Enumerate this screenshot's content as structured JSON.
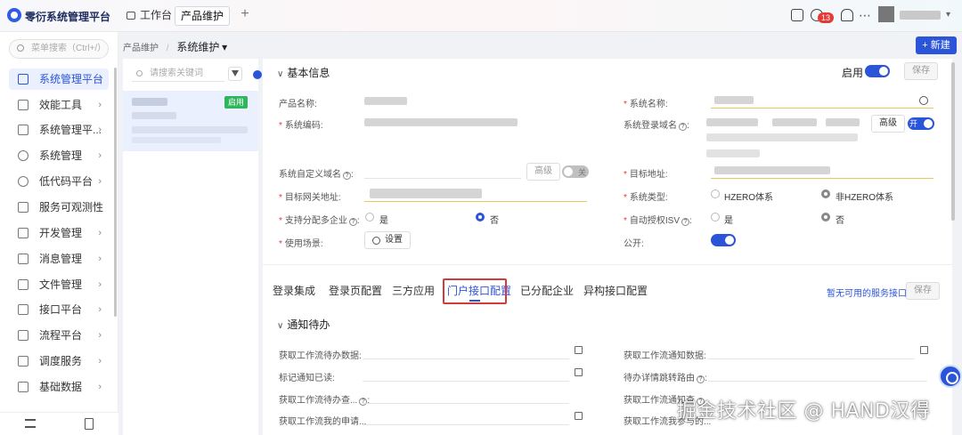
{
  "app": {
    "title": "零衍系统管理平台"
  },
  "tabs": [
    {
      "label": "工作台"
    },
    {
      "label": "产品维护"
    }
  ],
  "header": {
    "notification_count": "13"
  },
  "sidebar": {
    "search_placeholder": "菜单搜索（Ctrl+/）",
    "items": [
      {
        "label": "系统管理平台"
      },
      {
        "label": "效能工具"
      },
      {
        "label": "系统管理平..."
      },
      {
        "label": "系统管理"
      },
      {
        "label": "低代码平台"
      },
      {
        "label": "服务可观测性"
      },
      {
        "label": "开发管理"
      },
      {
        "label": "消息管理"
      },
      {
        "label": "文件管理"
      },
      {
        "label": "接口平台"
      },
      {
        "label": "流程平台"
      },
      {
        "label": "调度服务"
      },
      {
        "label": "基础数据"
      }
    ]
  },
  "breadcrumb": {
    "parent": "产品维护",
    "current": "系统维护"
  },
  "toolbar": {
    "new_label": "新建"
  },
  "listpane": {
    "search_placeholder": "请搜索关键词",
    "status_tag": "启用"
  },
  "basic": {
    "title": "基本信息",
    "enable_label": "启用",
    "save_label": "保存",
    "fields": {
      "product_name": "产品名称:",
      "system_name": "系统名称:",
      "system_code": "系统编码:",
      "login_domain": "系统登录域名",
      "advanced": "高级",
      "switch_on": "开",
      "switch_off": "关",
      "custom_domain": "系统自定义域名",
      "target_addr": "目标地址:",
      "gateway_addr": "目标网关地址:",
      "system_type": "系统类型:",
      "type_opt1": "HZERO体系",
      "type_opt2": "非HZERO体系",
      "multi_tenant": "支持分配多企业",
      "yes": "是",
      "no": "否",
      "auto_isv": "自动授权ISV",
      "usage_scene": "使用场景:",
      "settings_btn": "设置",
      "public": "公开:"
    }
  },
  "config_tabs": {
    "items": [
      {
        "label": "登录集成"
      },
      {
        "label": "登录页配置"
      },
      {
        "label": "三方应用"
      },
      {
        "label": "门户接口配置"
      },
      {
        "label": "已分配企业"
      },
      {
        "label": "异构接口配置"
      }
    ],
    "unavailable_link": "暂无可用的服务接口...",
    "save_label": "保存"
  },
  "notify": {
    "title": "通知待办",
    "fields": [
      "获取工作流待办数据:",
      "获取工作流通知数据:",
      "标记通知已读:",
      "待办详情跳转路由",
      "获取工作流待办查...",
      "获取工作流通知查",
      "获取工作流我的申请...",
      "获取工作流我参与的..."
    ]
  },
  "watermark": "掘金技术社区 @ HAND汉得"
}
